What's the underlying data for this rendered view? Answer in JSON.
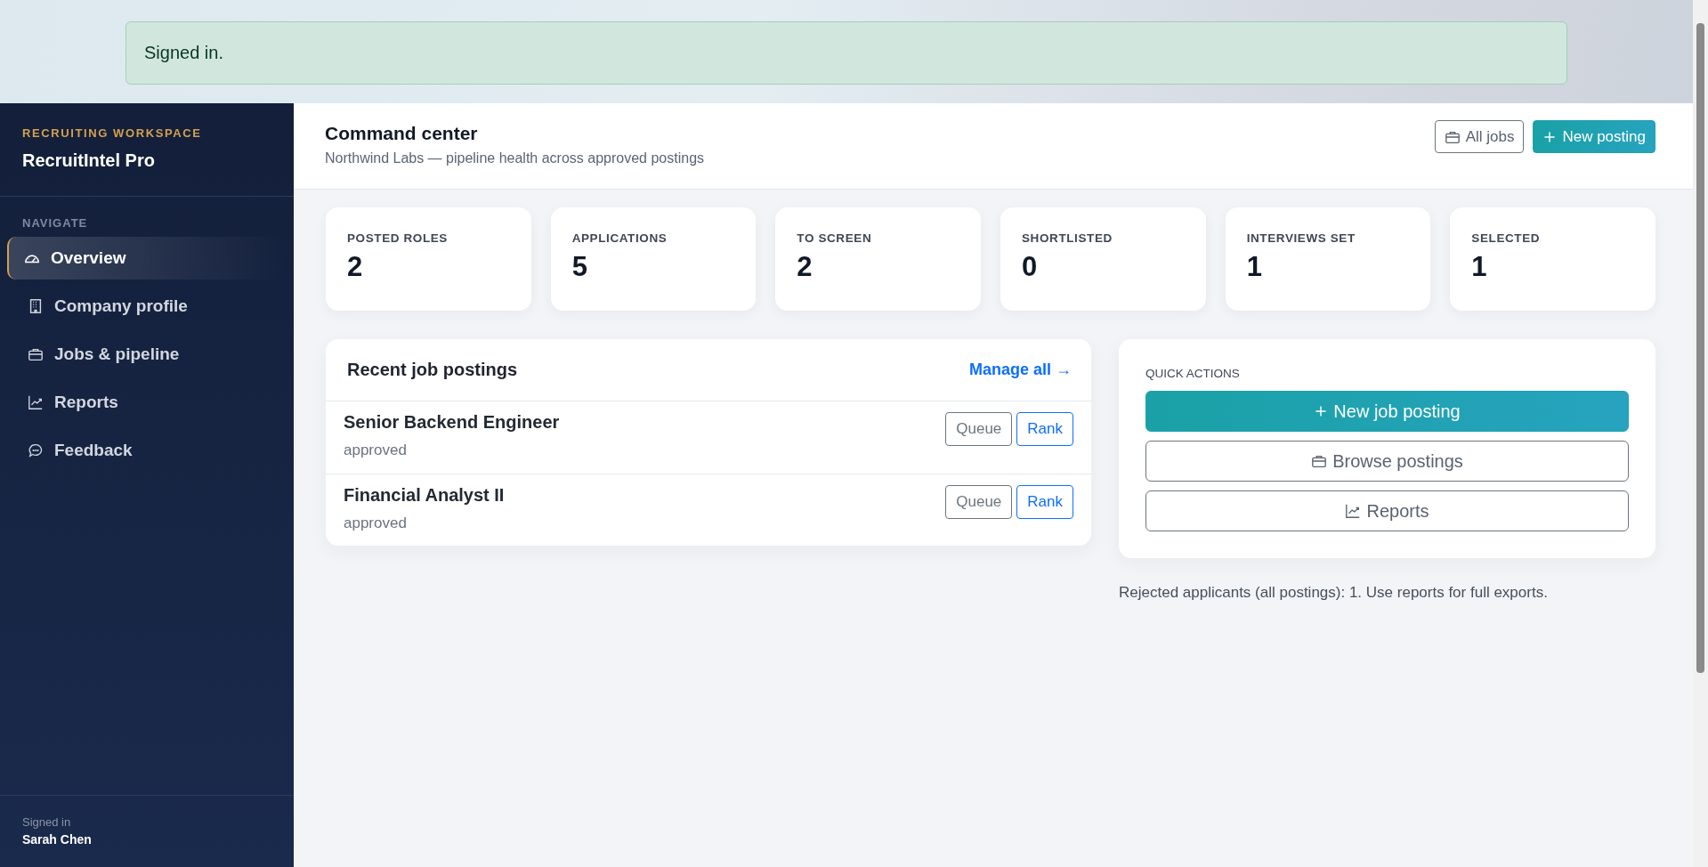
{
  "alert": {
    "text": "Signed in."
  },
  "sidebar": {
    "eyebrow": "RECRUITING WORKSPACE",
    "brand": "RecruitIntel Pro",
    "section_label": "NAVIGATE",
    "items": [
      {
        "label": "Overview",
        "kind": "overview",
        "selected": true
      },
      {
        "label": "Company profile",
        "kind": "company",
        "selected": false
      },
      {
        "label": "Jobs & pipeline",
        "kind": "jobs",
        "selected": false
      },
      {
        "label": "Reports",
        "kind": "reports",
        "selected": false
      },
      {
        "label": "Feedback",
        "kind": "feedback",
        "selected": false
      }
    ],
    "footer": {
      "label": "Signed in",
      "user": "Sarah Chen"
    }
  },
  "header": {
    "title": "Command center",
    "subtitle": "Northwind Labs — pipeline health across approved postings",
    "buttons": [
      {
        "label": "All jobs",
        "kind": "browse"
      },
      {
        "label": "New posting",
        "kind": "create"
      }
    ]
  },
  "stats": [
    {
      "label": "POSTED ROLES",
      "value": "2"
    },
    {
      "label": "APPLICATIONS",
      "value": "5"
    },
    {
      "label": "TO SCREEN",
      "value": "2"
    },
    {
      "label": "SHORTLISTED",
      "value": "0"
    },
    {
      "label": "INTERVIEWS SET",
      "value": "1"
    },
    {
      "label": "SELECTED",
      "value": "1"
    }
  ],
  "recent_postings": {
    "title": "Recent job postings",
    "link": "Manage all →",
    "rows": [
      {
        "title": "Senior Backend Engineer",
        "status": "approved",
        "actions": [
          {
            "label": "Queue",
            "kind": "secondary"
          },
          {
            "label": "Rank",
            "kind": "primary"
          }
        ]
      },
      {
        "title": "Financial Analyst II",
        "status": "approved",
        "actions": [
          {
            "label": "Queue",
            "kind": "secondary"
          },
          {
            "label": "Rank",
            "kind": "primary"
          }
        ]
      }
    ]
  },
  "quick_actions": {
    "title": "QUICK ACTIONS",
    "buttons": [
      {
        "label": "New job posting",
        "kind": "create"
      },
      {
        "label": "Browse postings",
        "kind": "browse"
      },
      {
        "label": "Reports",
        "kind": "reports"
      }
    ]
  },
  "note": "Rejected applicants (all postings): 1. Use reports for full exports."
}
